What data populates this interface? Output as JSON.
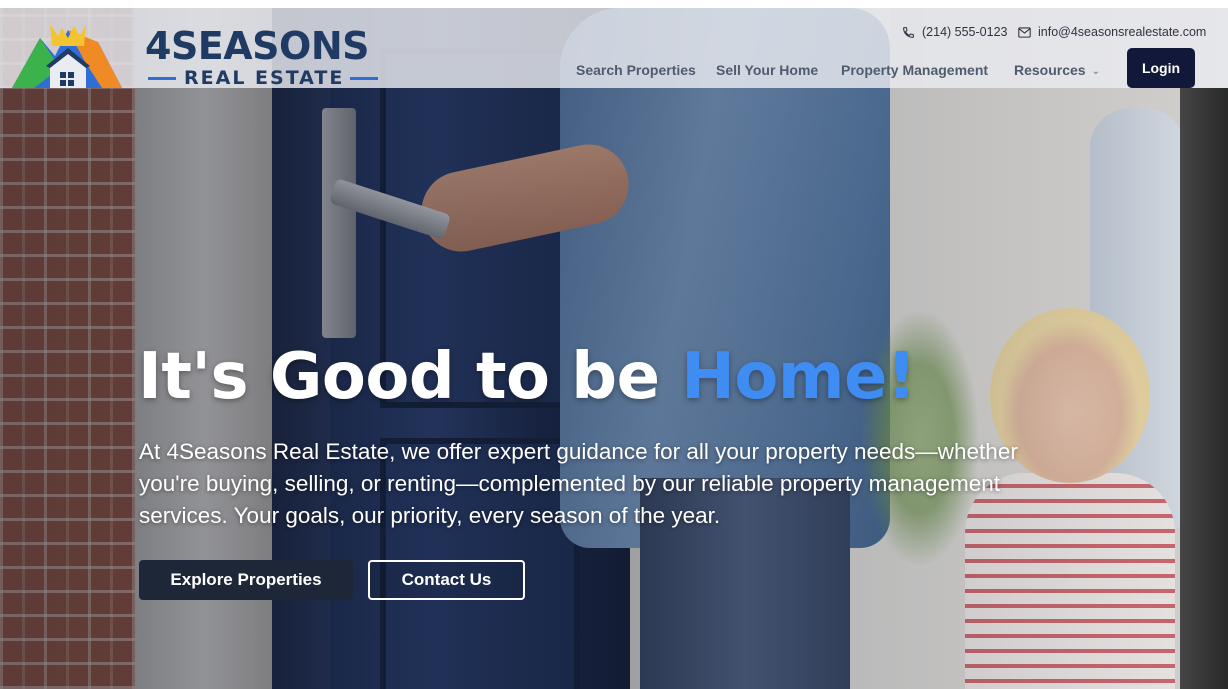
{
  "brand": {
    "name_top": "4SEASONS",
    "name_bottom": "REAL ESTATE",
    "logo_icon": "mountain-house-logo"
  },
  "contact": {
    "phone": "(214) 555-0123",
    "email": "info@4seasonsrealestate.com",
    "phone_icon": "phone-icon",
    "email_icon": "mail-icon"
  },
  "nav": {
    "items": [
      {
        "label": "Search Properties"
      },
      {
        "label": "Sell Your Home"
      },
      {
        "label": "Property Management"
      },
      {
        "label": "Resources",
        "has_dropdown": true
      }
    ],
    "login_label": "Login"
  },
  "hero": {
    "headline_prefix": "It's Good to be ",
    "headline_accent": "Home!",
    "description": "At 4Seasons Real Estate, we offer expert guidance for all your property needs—whether you're buying, selling, or renting—complemented by our reliable property management services. Your goals, our priority, every season of the year.",
    "primary_button": "Explore Properties",
    "secondary_button": "Contact Us"
  },
  "colors": {
    "brand_navy": "#1f3a63",
    "brand_blue": "#2f6ed6",
    "accent_blue": "#3f8cf2",
    "login_bg": "#12183a",
    "primary_button_bg": "#1d2738"
  }
}
